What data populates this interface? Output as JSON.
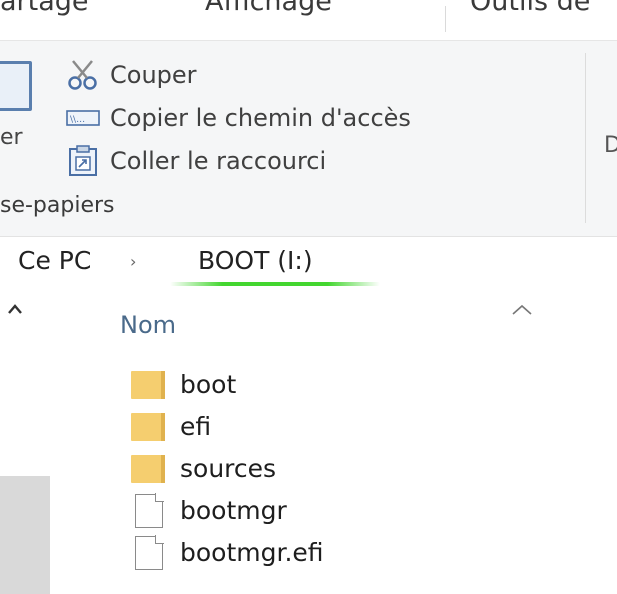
{
  "ribbon_tabs": {
    "partage": "artage",
    "affichage": "Affichage",
    "outils": "Outils de"
  },
  "clipboard": {
    "paste_label_partial": "er",
    "commands": [
      {
        "label": "Couper",
        "icon": "scissors-icon"
      },
      {
        "label": "Copier le chemin d'accès",
        "icon": "copy-path-icon"
      },
      {
        "label": "Coller le raccourci",
        "icon": "paste-shortcut-icon"
      }
    ],
    "group_label": "se-papiers",
    "next_group_partial": "D"
  },
  "address": {
    "root": "Ce PC",
    "separator": "›",
    "current": "BOOT (I:)"
  },
  "list": {
    "column_name": "Nom",
    "items": [
      {
        "name": "boot",
        "type": "folder"
      },
      {
        "name": "efi",
        "type": "folder"
      },
      {
        "name": "sources",
        "type": "folder"
      },
      {
        "name": "bootmgr",
        "type": "file"
      },
      {
        "name": "bootmgr.efi",
        "type": "file"
      }
    ]
  },
  "colors": {
    "folder": "#f5ce6f",
    "focus_underline": "#43d62f",
    "ribbon_bg": "#f5f6f7",
    "header_text": "#4a6a8a"
  }
}
